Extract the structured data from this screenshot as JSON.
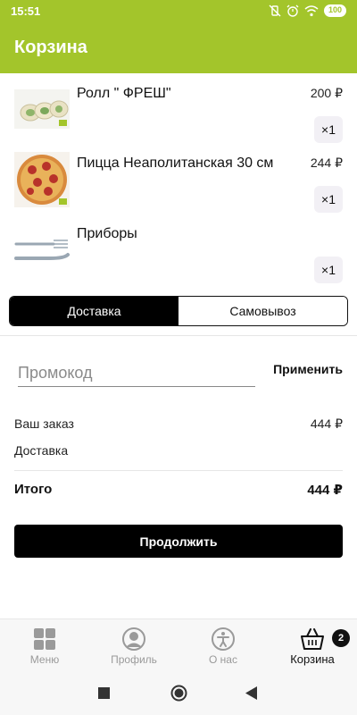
{
  "status_bar": {
    "time": "15:51",
    "battery": "100"
  },
  "header": {
    "title": "Корзина"
  },
  "cart": {
    "items": [
      {
        "name": "Ролл \" ФРЕШ\"",
        "price": "200 ₽",
        "quantity": "×1",
        "image": "roll-image"
      },
      {
        "name": "Пицца Неаполитанская 30 см",
        "price": "244 ₽",
        "quantity": "×1",
        "image": "pizza-image"
      },
      {
        "name": "Приборы",
        "price": "",
        "quantity": "×1",
        "image": "cutlery-image"
      }
    ]
  },
  "delivery_toggle": {
    "options": [
      "Доставка",
      "Самовывоз"
    ],
    "selected": "Доставка"
  },
  "promo": {
    "placeholder": "Промокод",
    "value": "",
    "apply_label": "Применить"
  },
  "summary": {
    "order_label": "Ваш заказ",
    "order_value": "444 ₽",
    "delivery_label": "Доставка",
    "delivery_value": "",
    "total_label": "Итого",
    "total_value": "444 ₽"
  },
  "continue_label": "Продолжить",
  "bottom_nav": {
    "items": [
      {
        "label": "Меню",
        "icon": "menu-grid-icon",
        "active": false
      },
      {
        "label": "Профиль",
        "icon": "profile-icon",
        "active": false
      },
      {
        "label": "О нас",
        "icon": "info-icon",
        "active": false
      },
      {
        "label": "Корзина",
        "icon": "basket-icon",
        "active": true,
        "badge": "2"
      }
    ]
  },
  "colors": {
    "brand": "#a3c52b",
    "button": "#000000",
    "inactive_nav": "#9a9a9a"
  }
}
